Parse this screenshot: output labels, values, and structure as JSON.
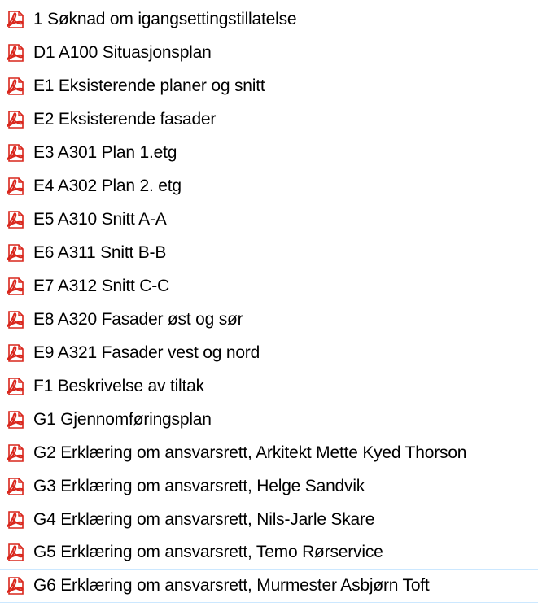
{
  "files": [
    {
      "name": "1 Søknad om igangsettingstillatelse",
      "icon": "pdf-icon"
    },
    {
      "name": "D1 A100 Situasjonsplan",
      "icon": "pdf-icon"
    },
    {
      "name": "E1 Eksisterende planer og snitt",
      "icon": "pdf-icon"
    },
    {
      "name": "E2 Eksisterende fasader",
      "icon": "pdf-icon"
    },
    {
      "name": "E3 A301 Plan 1.etg",
      "icon": "pdf-icon"
    },
    {
      "name": "E4 A302 Plan 2. etg",
      "icon": "pdf-icon"
    },
    {
      "name": "E5 A310 Snitt A-A",
      "icon": "pdf-icon"
    },
    {
      "name": "E6 A311 Snitt B-B",
      "icon": "pdf-icon"
    },
    {
      "name": "E7 A312 Snitt C-C",
      "icon": "pdf-icon"
    },
    {
      "name": "E8 A320 Fasader øst og sør",
      "icon": "pdf-icon"
    },
    {
      "name": "E9 A321 Fasader vest og nord",
      "icon": "pdf-icon"
    },
    {
      "name": "F1 Beskrivelse av tiltak",
      "icon": "pdf-icon"
    },
    {
      "name": "G1 Gjennomføringsplan",
      "icon": "pdf-icon"
    },
    {
      "name": "G2 Erklæring om ansvarsrett, Arkitekt Mette Kyed Thorson",
      "icon": "pdf-icon"
    },
    {
      "name": "G3 Erklæring om ansvarsrett, Helge Sandvik",
      "icon": "pdf-icon"
    },
    {
      "name": "G4 Erklæring om ansvarsrett, Nils-Jarle Skare",
      "icon": "pdf-icon"
    },
    {
      "name": "G5 Erklæring om ansvarsrett, Temo Rørservice",
      "icon": "pdf-icon"
    },
    {
      "name": "G6 Erklæring om ansvarsrett, Murmester Asbjørn Toft",
      "icon": "pdf-icon"
    }
  ],
  "colors": {
    "pdf_red": "#d9261c",
    "pdf_page": "#ffffff",
    "hover_line": "#cce8ff",
    "text": "#000000"
  }
}
